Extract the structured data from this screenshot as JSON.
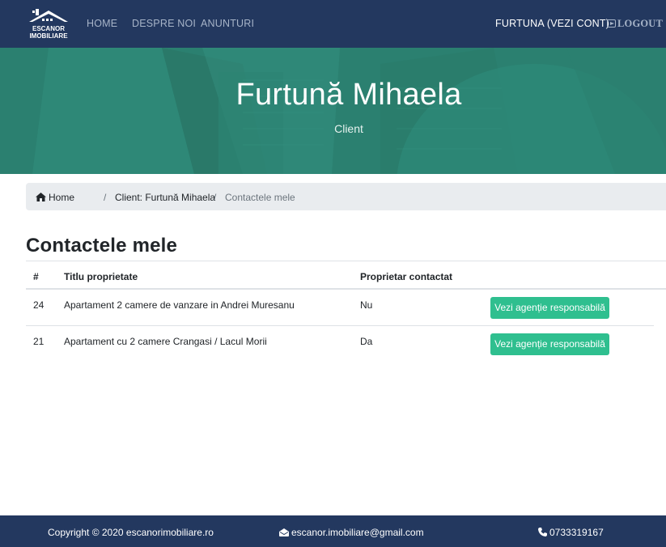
{
  "navbar": {
    "logo_text_line1": "ESCANOR",
    "logo_text_line2": "IMOBILIARE",
    "links": [
      "HOME",
      "DESPRE NOI",
      "ANUNTURI"
    ],
    "account": "FURTUNA (VEZI CONT)",
    "logout": "LOGOUT"
  },
  "hero": {
    "title": "Furtună Mihaela",
    "subtitle": "Client"
  },
  "breadcrumb": {
    "home": "Home",
    "client": "Client: Furtună Mihaela",
    "current": "Contactele mele",
    "separator": "/"
  },
  "page": {
    "title": "Contactele mele"
  },
  "table": {
    "headers": [
      "#",
      "Titlu proprietate",
      "Proprietar contactat",
      ""
    ],
    "rows": [
      {
        "id": "24",
        "title": "Apartament 2 camere de vanzare in Andrei Muresanu",
        "contacted": "Nu",
        "button": "Vezi agenție responsabilă"
      },
      {
        "id": "21",
        "title": "Apartament cu 2 camere Crangasi / Lacul Morii",
        "contacted": "Da",
        "button": "Vezi agenție responsabilă"
      }
    ]
  },
  "footer": {
    "copyright": "Copyright © 2020 escanorimobiliare.ro",
    "email": "escanor.imobiliare@gmail.com",
    "phone": "0733319167"
  },
  "colors": {
    "navbar": "#23385f",
    "hero": "#2f8c7b",
    "button": "#2fbf8f",
    "breadcrumb_bg": "#e9ecef"
  },
  "icons": [
    "house-logo-icon",
    "logout-icon",
    "home-icon",
    "envelope-icon",
    "phone-icon"
  ]
}
